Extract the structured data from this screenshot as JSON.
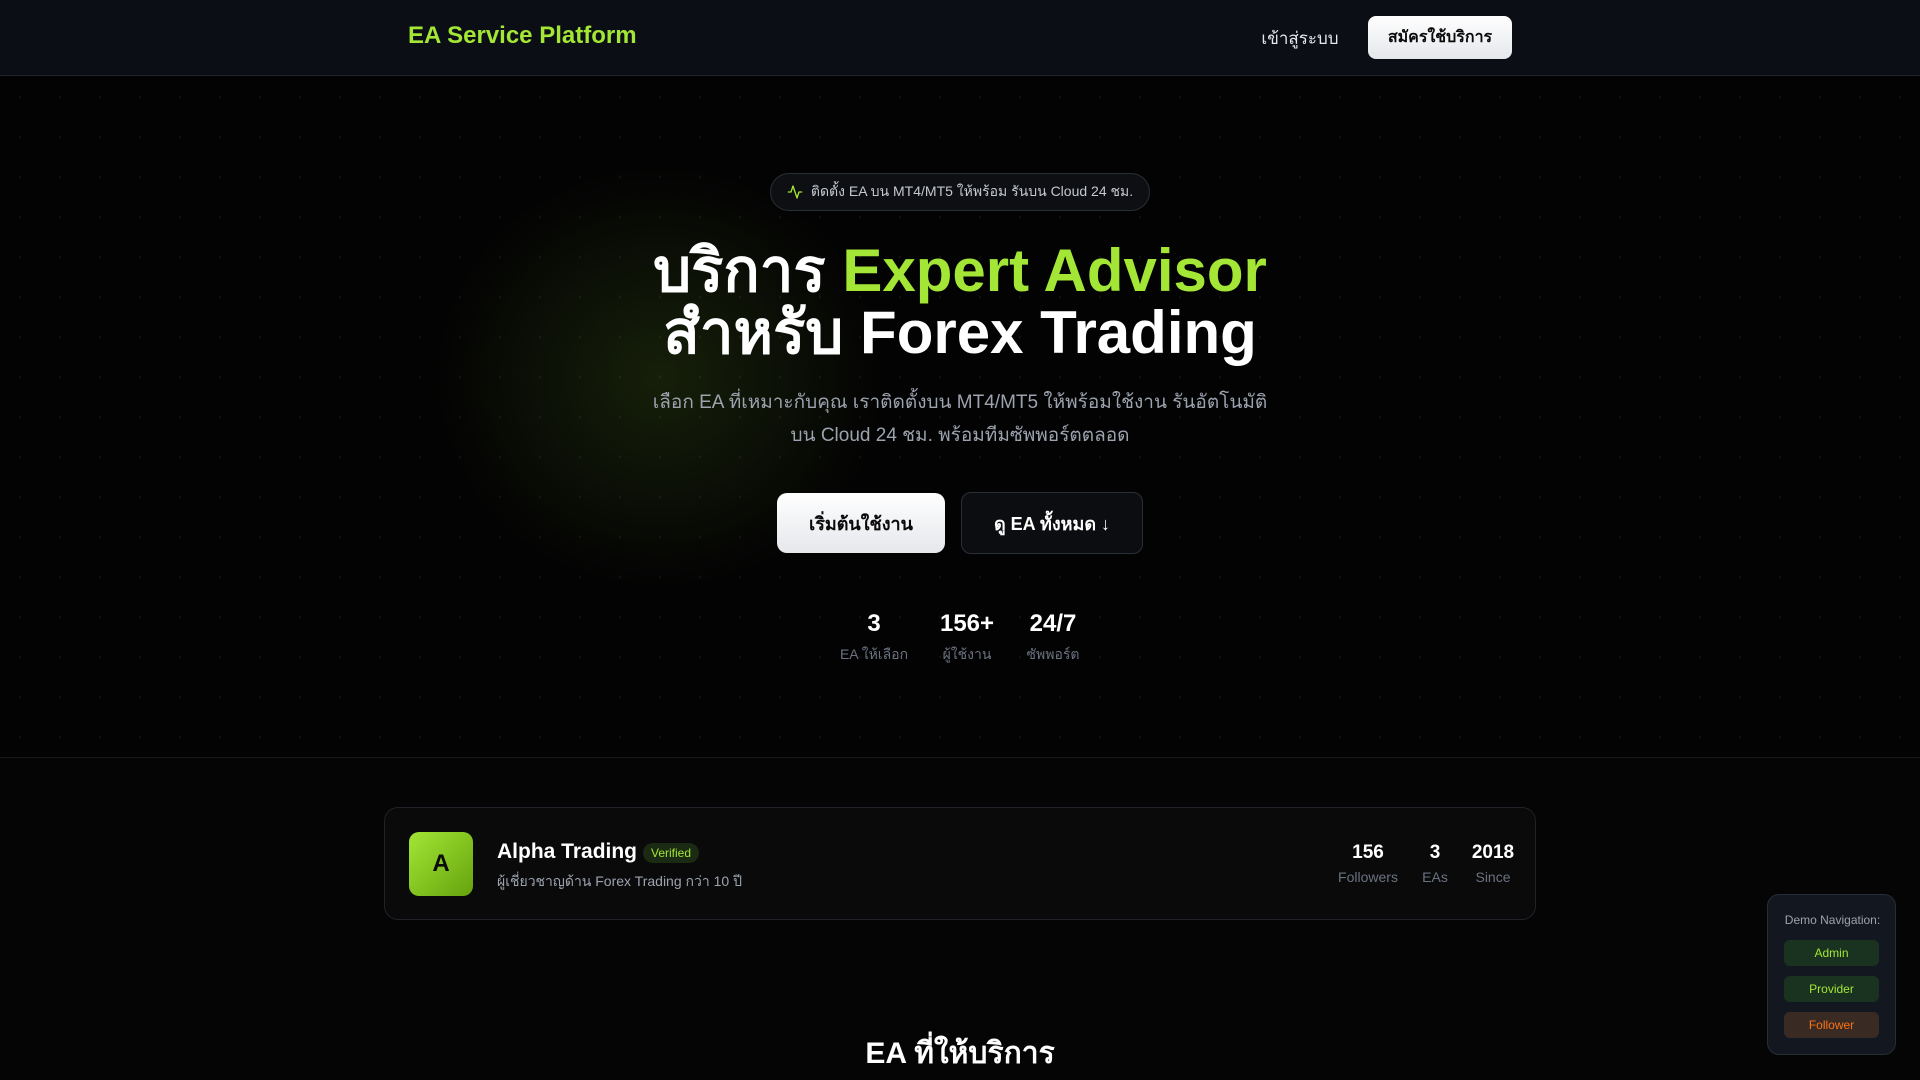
{
  "navbar": {
    "brand": "EA Service Platform",
    "login_label": "เข้าสู่ระบบ",
    "signup_label": "สมัครใช้บริการ"
  },
  "hero": {
    "pill_text": "ติดตั้ง EA บน MT4/MT5 ให้พร้อม รันบน Cloud 24 ชม.",
    "headline_part1": "บริการ ",
    "headline_accent": "Expert Advisor",
    "headline_line2": "สำหรับ Forex Trading",
    "subhead_line1": "เลือก EA ที่เหมาะกับคุณ เราติดตั้งบน MT4/MT5 ให้พร้อมใช้งาน รันอัตโนมัติ",
    "subhead_line2": "บน Cloud 24 ชม. พร้อมทีมซัพพอร์ตตลอด",
    "primary_button": "เริ่มต้นใช้งาน",
    "secondary_button": "ดู EA ทั้งหมด ↓",
    "stats": [
      {
        "value": "3",
        "label": "EA ให้เลือก"
      },
      {
        "value": "156+",
        "label": "ผู้ใช้งาน"
      },
      {
        "value": "24/7",
        "label": "ซัพพอร์ต"
      }
    ]
  },
  "provider": {
    "avatar_letter": "A",
    "name": "Alpha Trading",
    "badge": "Verified",
    "description": "ผู้เชี่ยวชาญด้าน Forex Trading กว่า 10 ปี",
    "stats": [
      {
        "value": "156",
        "label": "Followers"
      },
      {
        "value": "3",
        "label": "EAs"
      },
      {
        "value": "2018",
        "label": "Since"
      }
    ]
  },
  "section": {
    "title": "EA ที่ให้บริการ"
  },
  "demo_nav": {
    "title": "Demo Navigation:",
    "admin": "Admin",
    "provider": "Provider",
    "follower": "Follower"
  },
  "colors": {
    "accent": "#a3e635",
    "background": "#050505",
    "follower": "#f97316"
  },
  "icons": {
    "pill_icon": "activity-icon"
  }
}
